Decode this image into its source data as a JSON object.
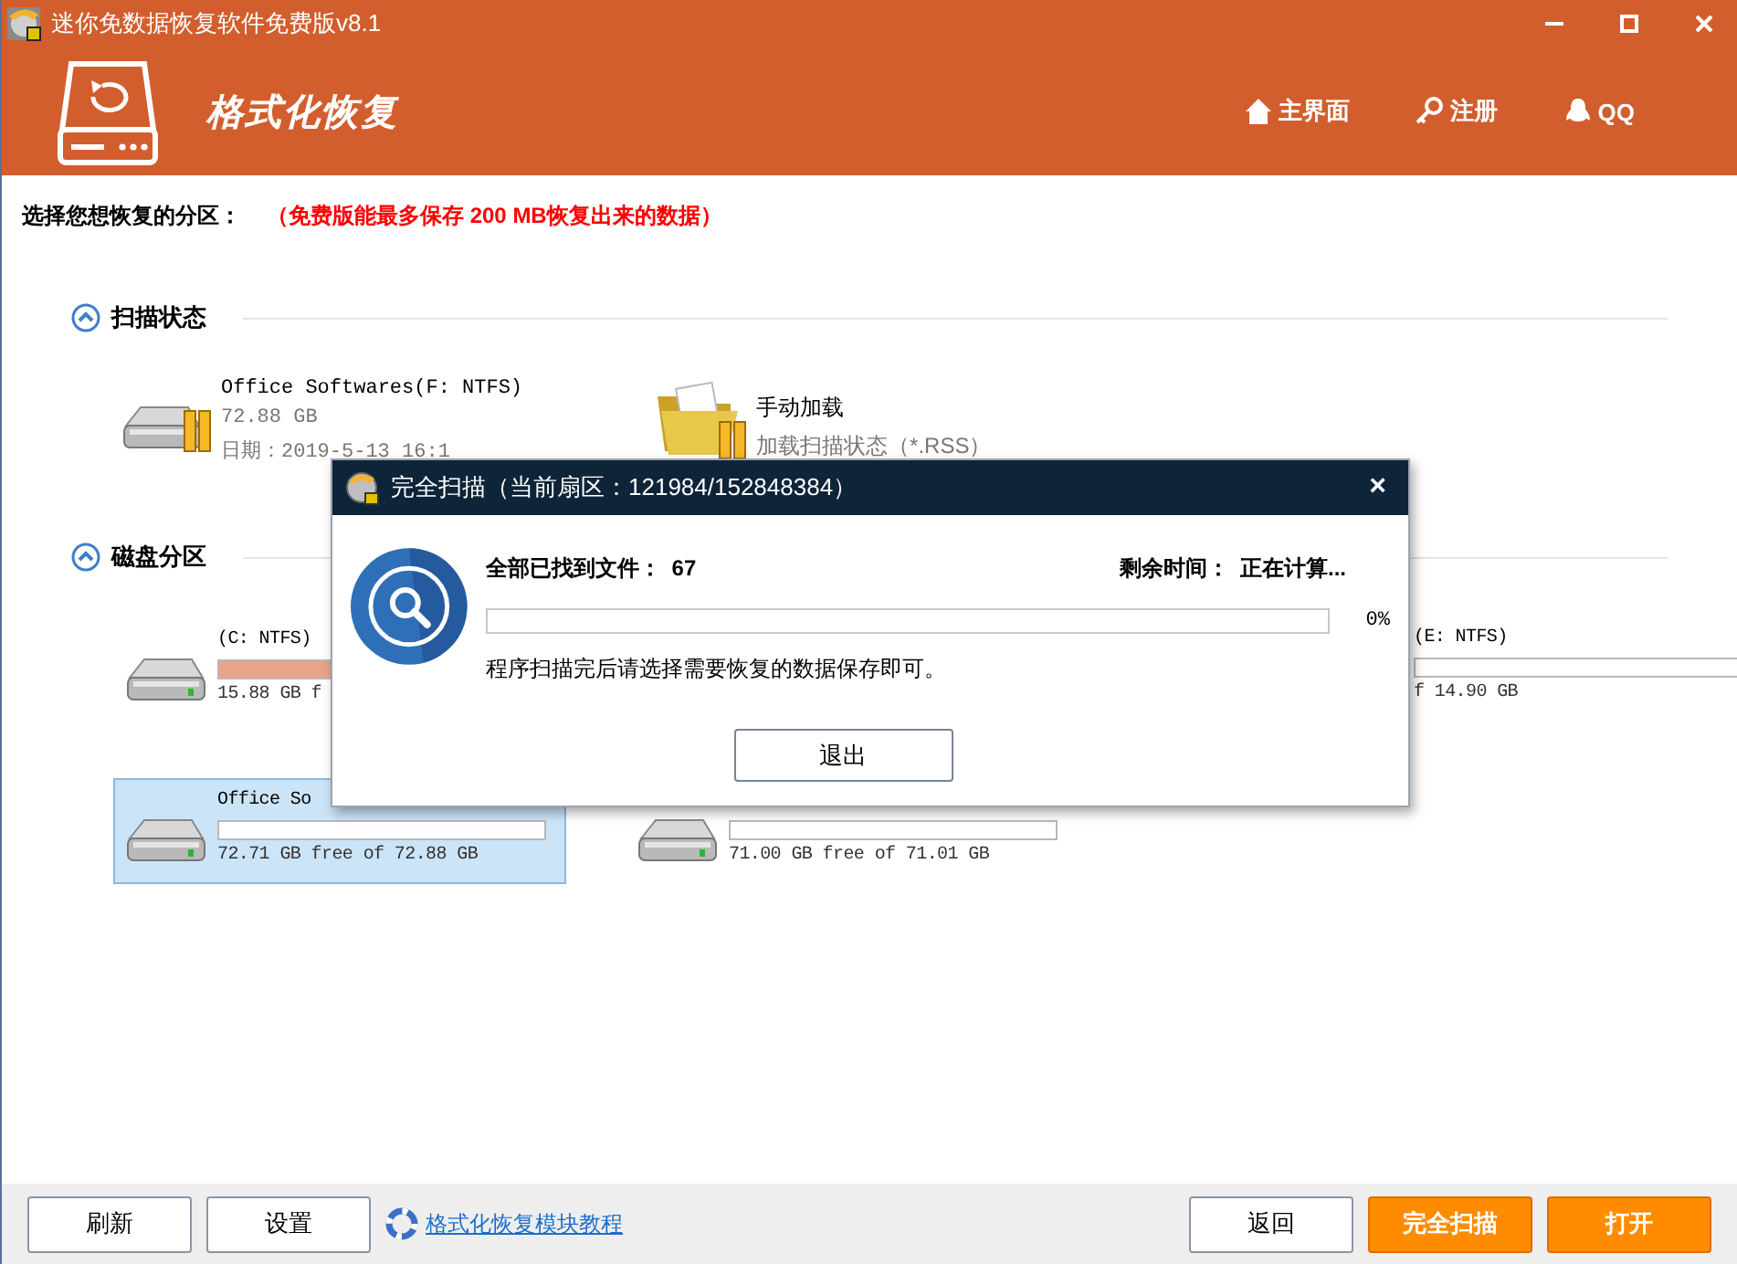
{
  "window": {
    "title": "迷你免数据恢复软件免费版v8.1"
  },
  "header": {
    "title": "格式化恢复",
    "nav": [
      {
        "kind": "home",
        "label": "主界面"
      },
      {
        "kind": "key",
        "label": "注册"
      },
      {
        "kind": "qq",
        "label": "QQ"
      }
    ]
  },
  "prompt": {
    "label": "选择您想恢复的分区：",
    "notice": "（免费版能最多保存 200 MB恢复出来的数据）"
  },
  "scan_status": {
    "title": "扫描状态",
    "expanded": true,
    "items": [
      {
        "kind": "drive",
        "name": "Office Softwares(F: NTFS)",
        "size": "72.88 GB",
        "date": "日期：2019-5-13 16:1"
      },
      {
        "kind": "folder",
        "name": "手动加载",
        "detail": "加载扫描状态（*.RSS）"
      }
    ]
  },
  "partitions": {
    "title": "磁盘分区",
    "expanded": true,
    "items": [
      {
        "kind": "drive",
        "name": "(C: NTFS)",
        "level": 0.35,
        "free": "15.88 GB f",
        "selected": false
      },
      {
        "kind": "clipped",
        "name": "(E: NTFS)",
        "level": 0,
        "free": "f 14.90 GB",
        "selected": false
      },
      {
        "kind": "drive",
        "name": "Office So",
        "level": 0,
        "free": "72.71 GB free of 72.88 GB",
        "selected": true
      },
      {
        "kind": "drive",
        "level": 0,
        "free": "71.00 GB free of 71.01 GB",
        "selected": false
      }
    ]
  },
  "dialog": {
    "title": "完全扫描（当前扇区：121984/152848384）",
    "found_label": "全部已找到文件：",
    "found": "67",
    "remaining_label": "剩余时间：",
    "remaining": "正在计算...",
    "level": 0,
    "percent": "0%",
    "message": "程序扫描完后请选择需要恢复的数据保存即可。",
    "button": "退出",
    "close": "×"
  },
  "footer": {
    "left_buttons": [
      "刷新",
      "设置"
    ],
    "link": "格式化恢复模块教程",
    "right_buttons": [
      {
        "label": "返回",
        "primary": false
      },
      {
        "label": "完全扫描",
        "primary": true
      },
      {
        "label": "打开",
        "primary": true
      }
    ]
  }
}
